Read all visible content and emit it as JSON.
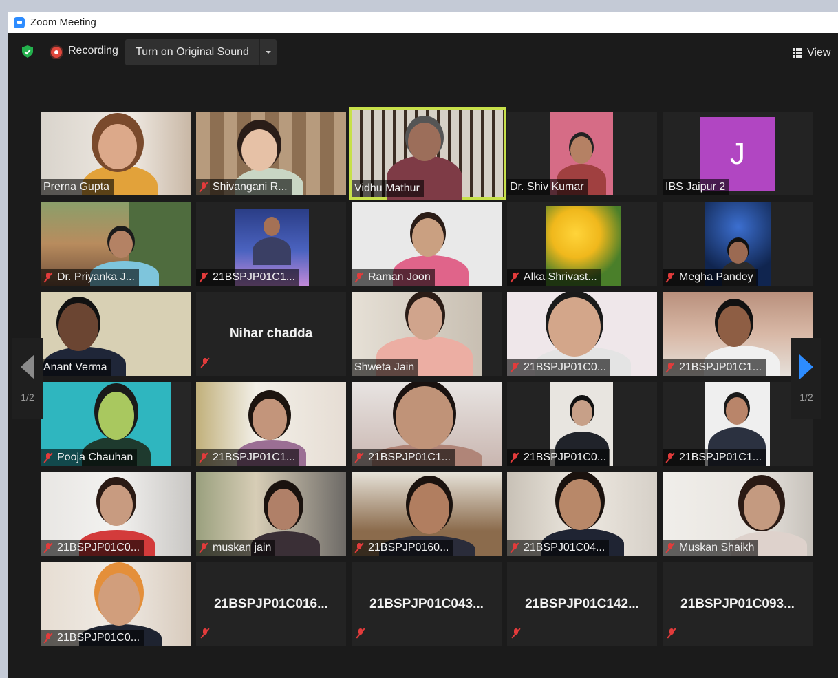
{
  "window": {
    "title": "Zoom Meeting"
  },
  "toolbar": {
    "recording_label": "Recording",
    "sound_button_label": "Turn on Original Sound",
    "view_label": "View"
  },
  "pagination": {
    "left_label": "1/2",
    "right_label": "1/2"
  },
  "colors": {
    "speaker_highlight": "#c7e04a",
    "avatar_bg": "#b146c2",
    "accent": "#2d8cff",
    "muted_mic": "#e23b3b"
  },
  "participants": [
    {
      "name": "Prerna Gupta"
    },
    {
      "name": "Shivangani R..."
    },
    {
      "name": "Vidhu Mathur"
    },
    {
      "name": "Dr. Shiv Kumar"
    },
    {
      "name": "IBS Jaipur 2",
      "avatar_letter": "J"
    },
    {
      "name": "Dr. Priyanka J..."
    },
    {
      "name": "21BSPJP01C1..."
    },
    {
      "name": "Raman Joon"
    },
    {
      "name": "Alka Shrivast..."
    },
    {
      "name": "Megha Pandey"
    },
    {
      "name": "Anant Verma"
    },
    {
      "name": "Nihar chadda"
    },
    {
      "name": "Shweta Jain"
    },
    {
      "name": "21BSPJP01C0..."
    },
    {
      "name": "21BSPJP01C1..."
    },
    {
      "name": "Pooja Chauhan"
    },
    {
      "name": "21BSPJP01C1..."
    },
    {
      "name": "21BSPJP01C1..."
    },
    {
      "name": "21BSPJP01C0..."
    },
    {
      "name": "21BSPJP01C1..."
    },
    {
      "name": "21BSPJP01C0..."
    },
    {
      "name": "muskan jain"
    },
    {
      "name": "21BSPJP0160..."
    },
    {
      "name": "21BSPJ01C04..."
    },
    {
      "name": "Muskan Shaikh"
    },
    {
      "name": "21BSPJP01C0..."
    },
    {
      "name": "21BSPJP01C016..."
    },
    {
      "name": "21BSPJP01C043..."
    },
    {
      "name": "21BSPJP01C142..."
    },
    {
      "name": "21BSPJP01C093..."
    }
  ]
}
